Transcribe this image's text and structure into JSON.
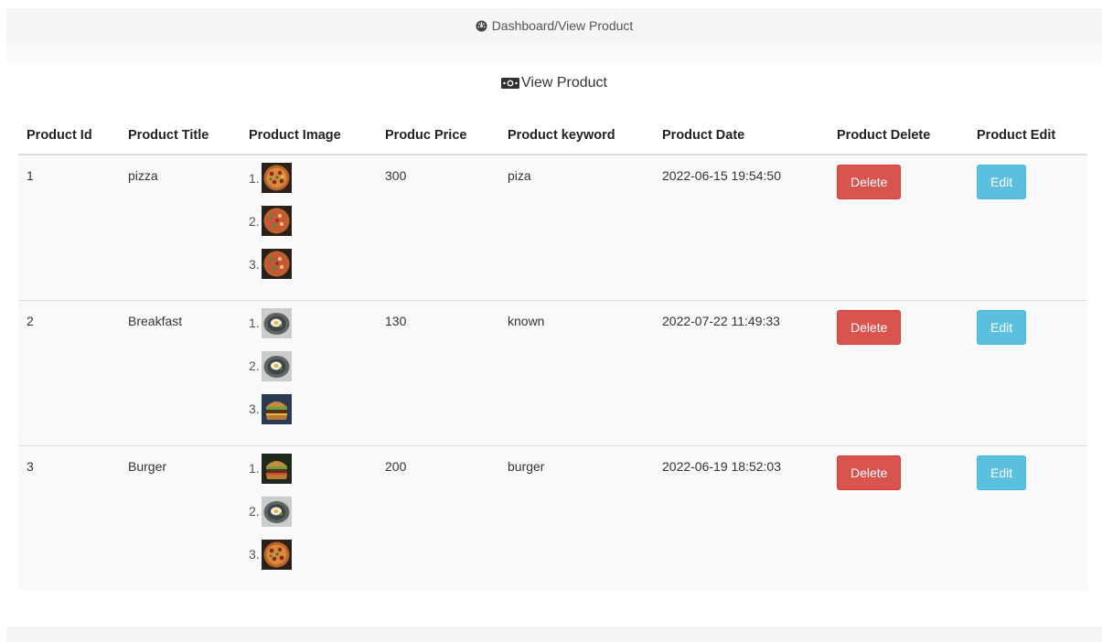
{
  "breadcrumb": {
    "icon": "dashboard-icon",
    "text": "Dashboard/View Product"
  },
  "panel": {
    "icon": "money-icon",
    "title": "View Product"
  },
  "table": {
    "headers": {
      "id": "Product Id",
      "title": "Product Title",
      "image": "Product Image",
      "price": "Produc Price",
      "keyword": "Product keyword",
      "date": "Product Date",
      "delete": "Product Delete",
      "edit": "Product Edit"
    },
    "rows": [
      {
        "id": "1",
        "title": "pizza",
        "images": [
          {
            "num": "1.",
            "kind": "pizza"
          },
          {
            "num": "2.",
            "kind": "pizza"
          },
          {
            "num": "3.",
            "kind": "pizza"
          }
        ],
        "price": "300",
        "keyword": "piza",
        "date": "2022-06-15 19:54:50",
        "delete_label": "Delete",
        "edit_label": "Edit"
      },
      {
        "id": "2",
        "title": "Breakfast",
        "images": [
          {
            "num": "1.",
            "kind": "plate"
          },
          {
            "num": "2.",
            "kind": "plate"
          },
          {
            "num": "3.",
            "kind": "burger"
          }
        ],
        "price": "130",
        "keyword": "known",
        "date": "2022-07-22 11:49:33",
        "delete_label": "Delete",
        "edit_label": "Edit"
      },
      {
        "id": "3",
        "title": "Burger",
        "images": [
          {
            "num": "1.",
            "kind": "burger"
          },
          {
            "num": "2.",
            "kind": "plate"
          },
          {
            "num": "3.",
            "kind": "pizza"
          }
        ],
        "price": "200",
        "keyword": "burger",
        "date": "2022-06-19 18:52:03",
        "delete_label": "Delete",
        "edit_label": "Edit"
      }
    ]
  },
  "colors": {
    "delete_button": "#d9534f",
    "edit_button": "#5bc0de",
    "row_background": "#f9f9f9",
    "breadcrumb_background": "#f5f5f5"
  }
}
